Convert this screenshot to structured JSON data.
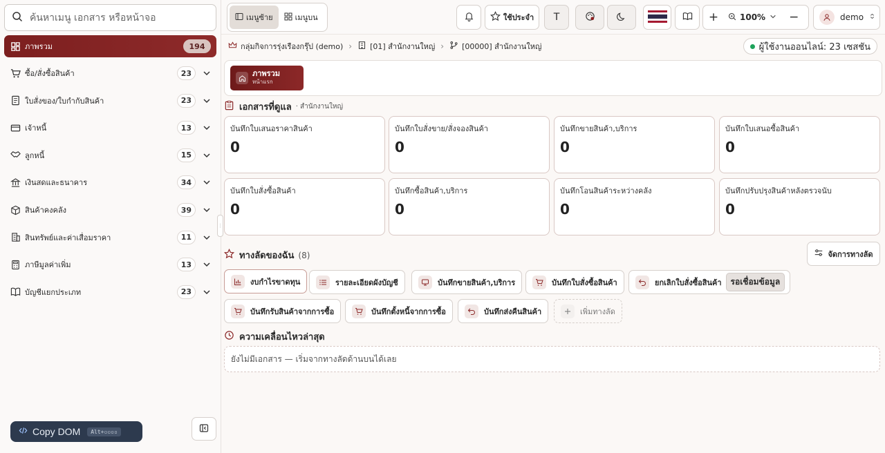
{
  "search": {
    "placeholder": "ค้นหาเมนู เอกสาร หรือหน้าจอ"
  },
  "sidebar": {
    "items": [
      {
        "label": "ภาพรวม",
        "count": "194",
        "icon": "dashboard-icon",
        "active": true
      },
      {
        "label": "ซื้อ/สั่งซื้อสินค้า",
        "count": "23",
        "icon": "cart-icon"
      },
      {
        "label": "ใบสั่งของ/ใบกำกับสินค้า",
        "count": "23",
        "icon": "document-icon"
      },
      {
        "label": "เจ้าหนี้",
        "count": "13",
        "icon": "credit-card-icon"
      },
      {
        "label": "ลูกหนี้",
        "count": "15",
        "icon": "handshake-icon"
      },
      {
        "label": "เงินสดและธนาคาร",
        "count": "34",
        "icon": "bank-icon"
      },
      {
        "label": "สินค้าคงคลัง",
        "count": "39",
        "icon": "box-icon"
      },
      {
        "label": "สินทรัพย์และค่าเสื่อมราคา",
        "count": "11",
        "icon": "building-icon"
      },
      {
        "label": "ภาษีมูลค่าเพิ่ม",
        "count": "13",
        "icon": "calculator-icon"
      },
      {
        "label": "บัญชีแยกประเภท",
        "count": "23",
        "icon": "book-icon"
      }
    ],
    "copy_dom": {
      "label": "Copy DOM",
      "shortcut": "Alt+▫▫▫▫"
    }
  },
  "topbar": {
    "menu_left": "เมนูซ้าย",
    "menu_top": "เมนูบน",
    "favorites": "ใช้ประจำ",
    "font_button": "T",
    "zoom": "100%",
    "user": "demo"
  },
  "breadcrumb": {
    "company": "กลุ่มกิจการรุ่งเรืองกรุ๊ป (demo)",
    "branch": "[01] สำนักงานใหญ่",
    "location": "[00000] สำนักงานใหญ่",
    "online": "ผู้ใช้งานออนไลน์: 23 เซสชัน"
  },
  "tab": {
    "title": "ภาพรวม",
    "subtitle": "หน้าแรก"
  },
  "docs": {
    "title": "เอกสารที่ดูแล",
    "subtitle": "· สำนักงานใหญ่",
    "cards": [
      {
        "label": "บันทึกใบเสนอราคาสินค้า",
        "value": "0"
      },
      {
        "label": "บันทึกใบสั่งขาย/สั่งจองสินค้า",
        "value": "0"
      },
      {
        "label": "บันทึกขายสินค้า,บริการ",
        "value": "0"
      },
      {
        "label": "บันทึกใบเสนอซื้อสินค้า",
        "value": "0"
      },
      {
        "label": "บันทึกใบสั่งซื้อสินค้า",
        "value": "0"
      },
      {
        "label": "บันทึกซื้อสินค้า,บริการ",
        "value": "0"
      },
      {
        "label": "บันทึกโอนสินค้าระหว่างคลัง",
        "value": "0"
      },
      {
        "label": "บันทึกปรับปรุงสินค้าหลังตรวจนับ",
        "value": "0"
      }
    ]
  },
  "shortcuts": {
    "title": "ทางลัดของฉัน",
    "count": "(8)",
    "manage": "จัดการทางลัด",
    "items": [
      {
        "label": "งบกำไรขาดทุน",
        "icon": "bar-chart-icon"
      },
      {
        "label": "รายละเอียดผังบัญชี",
        "icon": "list-icon"
      },
      {
        "label": "บันทึกขายสินค้า,บริการ",
        "icon": "receipt-icon"
      },
      {
        "label": "บันทึกใบสั่งซื้อสินค้า",
        "icon": "cart-icon"
      },
      {
        "label": "ยกเลิกใบสั่งซื้อสินค้า",
        "icon": "undo-icon",
        "badge": "รอเชื่อมข้อมูล"
      },
      {
        "label": "บันทึกรับสินค้าจากการซื้อ",
        "icon": "cart-icon"
      },
      {
        "label": "บันทึกตั้งหนี้จากการซื้อ",
        "icon": "cart-icon"
      },
      {
        "label": "บันทึกส่งคืนสินค้า",
        "icon": "undo-icon"
      }
    ],
    "add": "เพิ่มทางลัด"
  },
  "activity": {
    "title": "ความเคลื่อนไหวล่าสุด",
    "empty": "ยังไม่มีเอกสาร — เริ่มจากทางลัดด้านบนได้เลย"
  }
}
